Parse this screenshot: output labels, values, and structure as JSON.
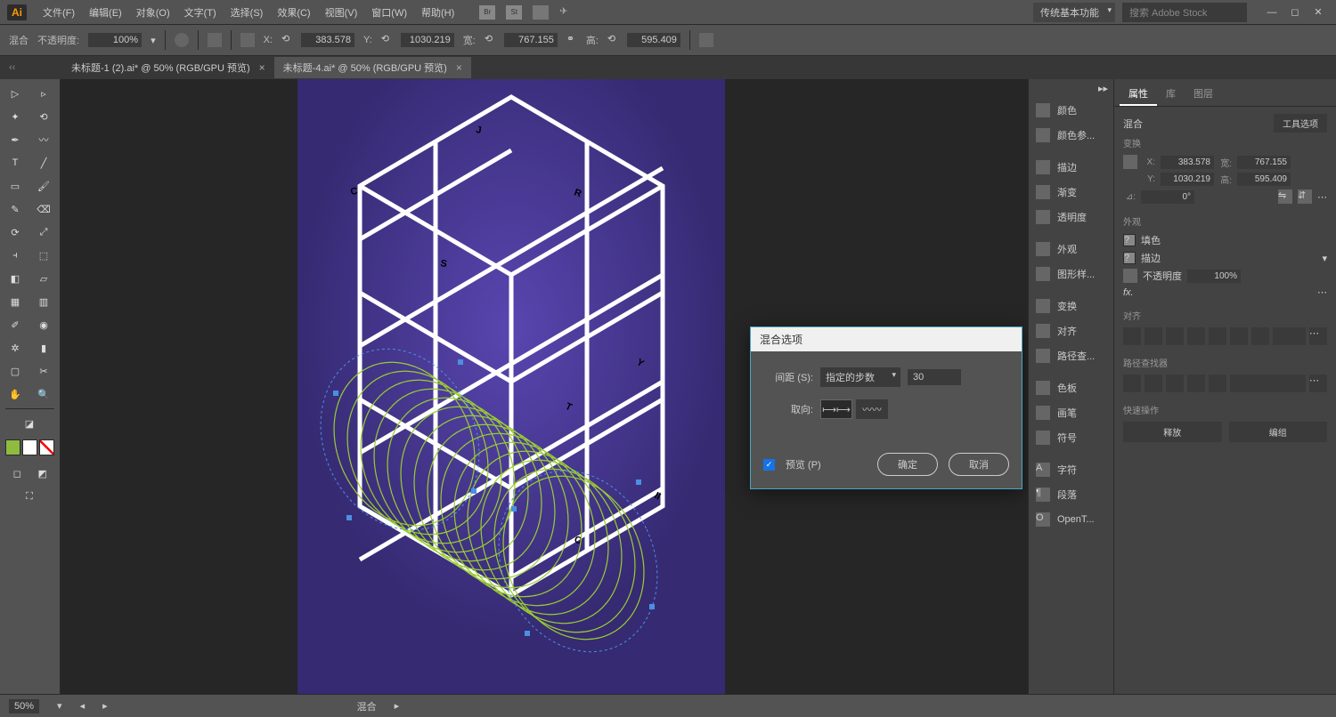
{
  "menubar": {
    "logo": "Ai",
    "items": [
      "文件(F)",
      "编辑(E)",
      "对象(O)",
      "文字(T)",
      "选择(S)",
      "效果(C)",
      "视图(V)",
      "窗口(W)",
      "帮助(H)"
    ],
    "workspace_preset": "传统基本功能",
    "search_placeholder": "搜索 Adobe Stock"
  },
  "optbar": {
    "mode": "混合",
    "opacity_label": "不透明度:",
    "opacity": "100%",
    "x_label": "X:",
    "x": "383.578",
    "y_label": "Y:",
    "y": "1030.219",
    "w_label": "宽:",
    "w": "767.155",
    "h_label": "高:",
    "h": "595.409"
  },
  "tabs": {
    "items": [
      {
        "label": "未标题-1 (2).ai* @ 50% (RGB/GPU 预览)",
        "active": false
      },
      {
        "label": "未标题-4.ai* @ 50% (RGB/GPU 预览)",
        "active": true
      }
    ]
  },
  "dialog": {
    "title": "混合选项",
    "spacing_label": "间距 (S):",
    "spacing_mode": "指定的步数",
    "spacing_value": "30",
    "orient_label": "取向:",
    "preview_label": "预览 (P)",
    "ok": "确定",
    "cancel": "取消"
  },
  "panel_strip": {
    "groups": [
      [
        "颜色",
        "颜色参..."
      ],
      [
        "描边",
        "渐变",
        "透明度"
      ],
      [
        "外观",
        "图形样..."
      ],
      [
        "变换",
        "对齐",
        "路径查..."
      ],
      [
        "色板",
        "画笔",
        "符号"
      ],
      [
        "字符",
        "段落",
        "OpenT..."
      ]
    ]
  },
  "props": {
    "tabs": [
      "属性",
      "库",
      "图层"
    ],
    "selection": "混合",
    "tool_options": "工具选项",
    "transform": {
      "heading": "变换",
      "x_label": "X:",
      "x": "383.578",
      "y_label": "Y:",
      "y": "1030.219",
      "w_label": "宽:",
      "w": "767.155",
      "h_label": "高:",
      "h": "595.409",
      "angle_label": "⊿:",
      "angle": "0°"
    },
    "appearance": {
      "heading": "外观",
      "fill_label": "填色",
      "stroke_label": "描边",
      "opacity_label": "不透明度",
      "opacity": "100%"
    },
    "align": {
      "heading": "对齐"
    },
    "pathfinder": {
      "heading": "路径查找器"
    },
    "quick": {
      "heading": "快速操作",
      "release": "释放",
      "group": "编组"
    }
  },
  "statusbar": {
    "zoom": "50%",
    "tool": "混合"
  }
}
